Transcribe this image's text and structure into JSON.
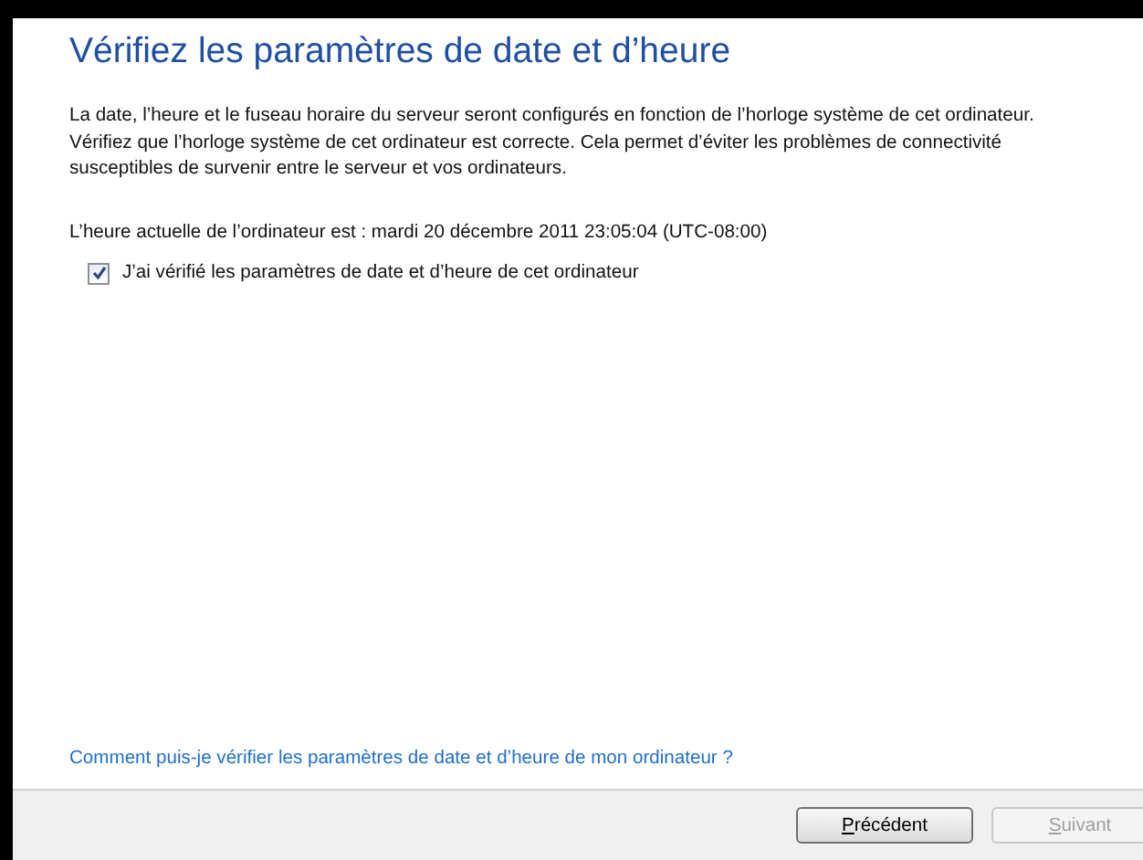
{
  "title": "Vérifiez les paramètres de date et d’heure",
  "description": "La date, l’heure et le fuseau horaire du serveur seront configurés en fonction de l’horloge système de cet ordinateur. Vérifiez que l’horloge système de cet ordinateur est correcte. Cela permet d’éviter les problèmes de connectivité susceptibles de survenir entre le serveur et vos ordinateurs.",
  "current_time": "L’heure actuelle de l’ordinateur est : mardi 20 décembre 2011 23:05:04 (UTC-08:00)",
  "confirm": {
    "label": "J’ai vérifié les paramètres de date et d’heure de cet ordinateur",
    "checked": true
  },
  "help_link": "Comment puis-je vérifier les paramètres de date et d’heure de mon ordinateur ?",
  "buttons": [
    {
      "label": "Précédent",
      "disabled": false
    },
    {
      "label": "Suivant",
      "disabled": true
    }
  ]
}
